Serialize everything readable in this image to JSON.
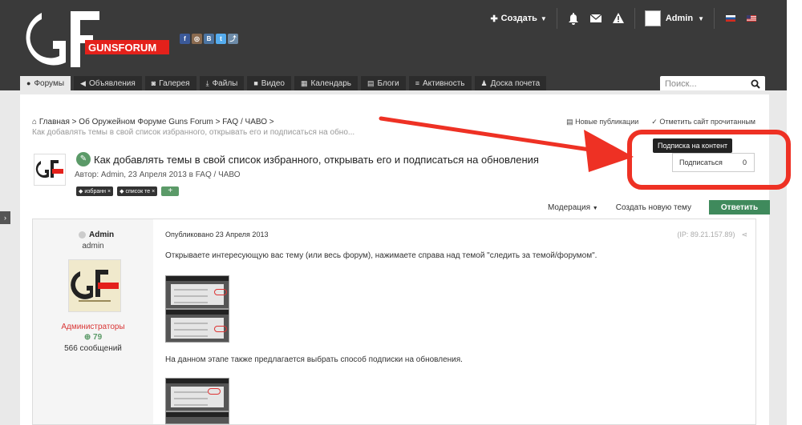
{
  "header": {
    "logo_text": "GUNSFORUM",
    "social_icons": [
      "facebook-icon",
      "instagram-icon",
      "vk-icon",
      "twitter-icon",
      "link-icon"
    ],
    "create_label": "Создать",
    "user_name": "Admin"
  },
  "tabs": [
    {
      "label": "Форумы",
      "icon": "comments-icon",
      "active": true
    },
    {
      "label": "Объявления",
      "icon": "bullhorn-icon"
    },
    {
      "label": "Галерея",
      "icon": "camera-icon"
    },
    {
      "label": "Файлы",
      "icon": "download-icon"
    },
    {
      "label": "Видео",
      "icon": "video-icon"
    },
    {
      "label": "Календарь",
      "icon": "calendar-icon"
    },
    {
      "label": "Блоги",
      "icon": "file-icon"
    },
    {
      "label": "Активность",
      "icon": "list-icon"
    },
    {
      "label": "Доска почета",
      "icon": "user-icon"
    }
  ],
  "search": {
    "placeholder": "Поиск..."
  },
  "breadcrumb": {
    "home": "Главная",
    "level1": "Об Оружейном Форуме Guns Forum",
    "level2": "FAQ / ЧАВО",
    "current": "Как добавлять темы в свой список избранного, открывать его и подписаться на обно..."
  },
  "page_actions": {
    "new_posts": "Новые публикации",
    "mark_read": "Отметить сайт прочитанным"
  },
  "topic": {
    "title": "Как добавлять темы в свой список избранного, открывать его и подписаться на обновления",
    "meta": "Автор: Admin, 23 Апреля 2013 в FAQ / ЧАВО",
    "tags": [
      "избранн",
      "список те"
    ]
  },
  "actions": {
    "moderation": "Модерация",
    "new_topic": "Создать новую тему",
    "reply": "Ответить"
  },
  "follow": {
    "tooltip": "Подписка на контент",
    "label": "Подписаться",
    "count": "0"
  },
  "post": {
    "author": "Admin",
    "author_title": "admin",
    "group": "Администраторы",
    "reputation": "79",
    "post_count": "566 сообщений",
    "date": "Опубликовано 23 Апреля 2013",
    "ip": "(IP: 89.21.157.89)",
    "text1": "Открываете интересующую вас тему (или весь форум), нажимаете справа над темой \"следить за темой/форумом\".",
    "text2": "На данном этапе также предлагается выбрать способ подписки на обновления."
  },
  "colors": {
    "header": "#3a3a3a",
    "accent_green": "#3f8a5c",
    "callout_red": "#ee3124",
    "group_red": "#d93636"
  }
}
